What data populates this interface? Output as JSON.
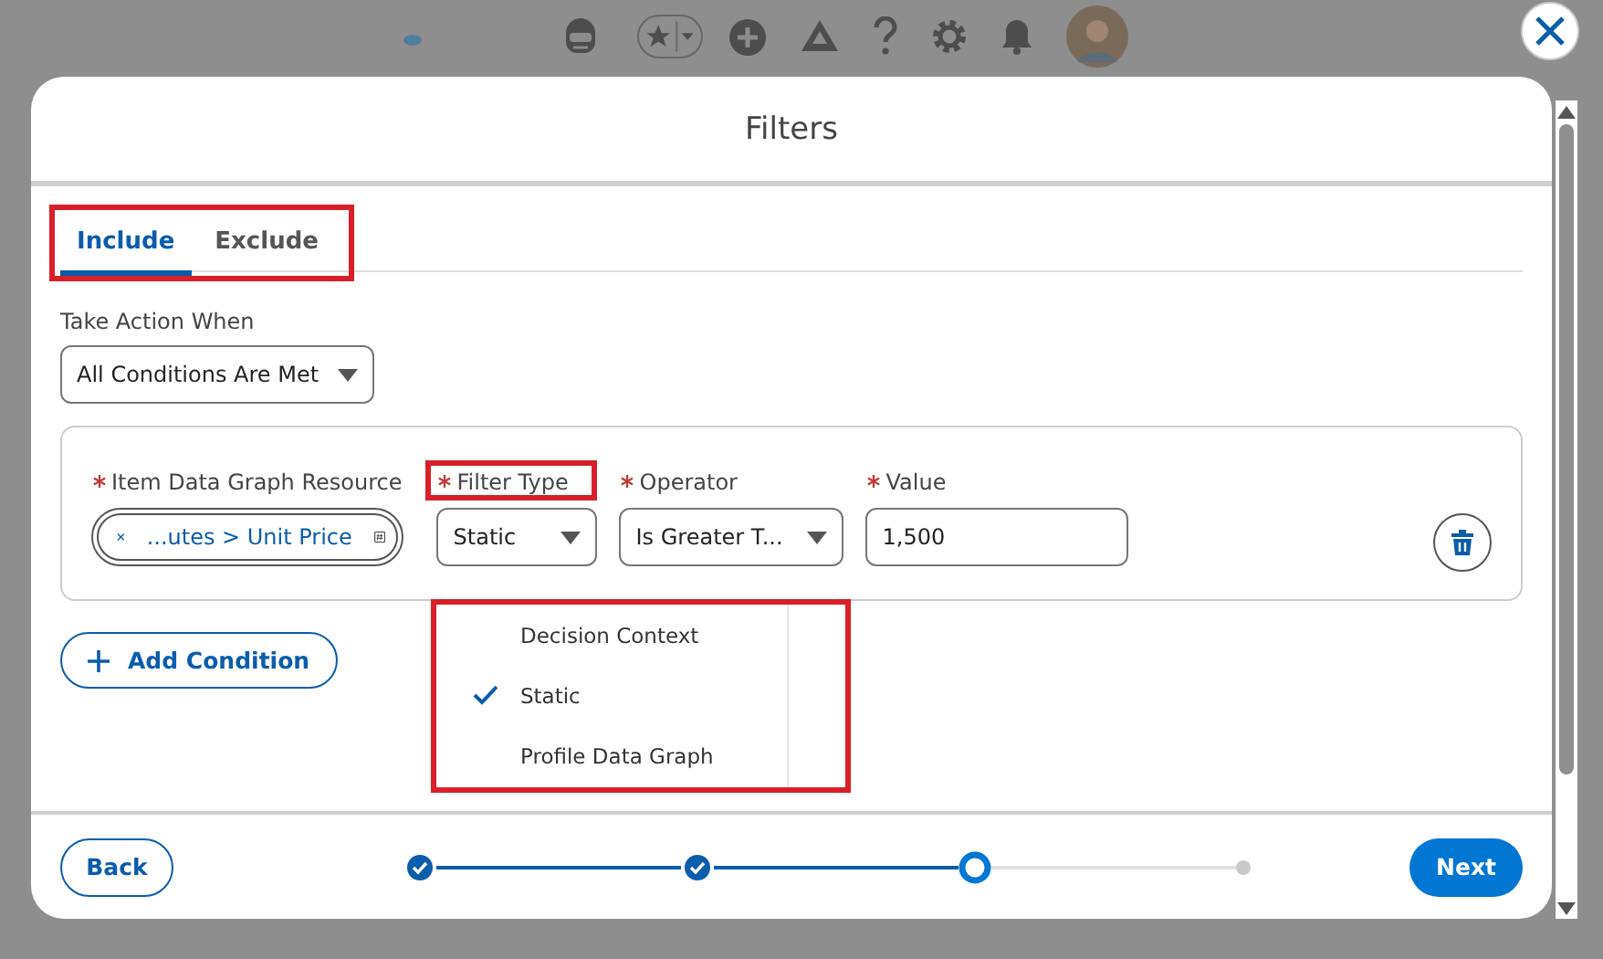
{
  "modal": {
    "title": "Filters"
  },
  "tabs": [
    {
      "label": "Include",
      "selected": true
    },
    {
      "label": "Exclude",
      "selected": false
    }
  ],
  "tabs_highlighted": true,
  "action": {
    "label": "Take Action When",
    "value": "All Conditions Are Met"
  },
  "condition": {
    "fields": [
      {
        "kind": "pill",
        "label": "Item Data Graph Resource",
        "required": true,
        "value": "...utes > Unit Price",
        "highlighted": false
      },
      {
        "kind": "select",
        "label": "Filter Type",
        "required": true,
        "value": "Static",
        "highlighted": true
      },
      {
        "kind": "select",
        "label": "Operator",
        "required": true,
        "value": "Is Greater T...",
        "highlighted": false
      },
      {
        "kind": "input",
        "label": "Value",
        "required": true,
        "value": "1,500",
        "highlighted": false
      }
    ]
  },
  "menu": {
    "highlighted": true,
    "options": [
      {
        "label": "Decision Context",
        "selected": false
      },
      {
        "label": "Static",
        "selected": true
      },
      {
        "label": "Profile Data Graph",
        "selected": false
      }
    ]
  },
  "add_condition": "Add Condition",
  "back": "Back",
  "next": "Next",
  "steps": [
    {
      "completed": true,
      "selected": false
    },
    {
      "completed": true,
      "selected": false
    },
    {
      "completed": false,
      "selected": true
    },
    {
      "completed": false,
      "selected": false
    }
  ]
}
